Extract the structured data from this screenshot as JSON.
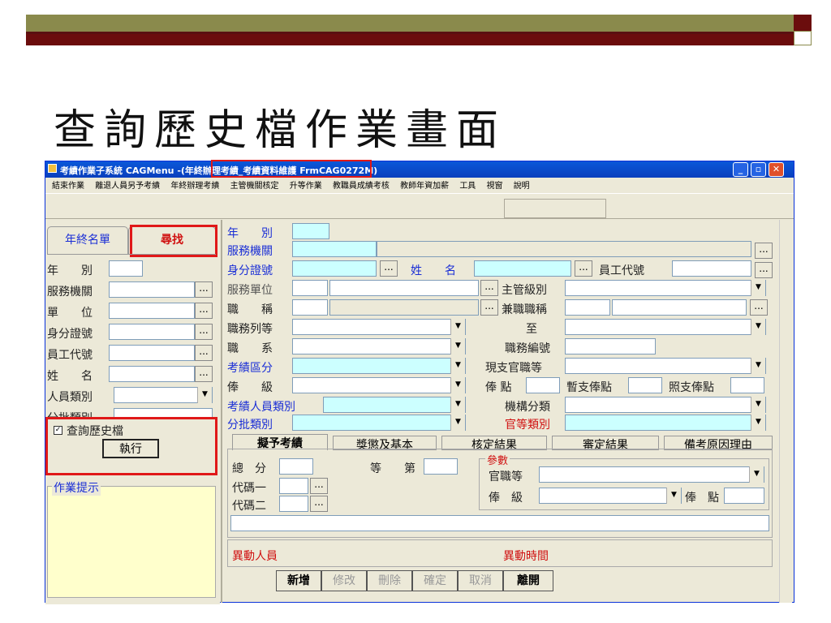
{
  "slide": {
    "title": "查詢歷史檔作業畫面"
  },
  "window": {
    "title": "考績作業子系統 CAGMenu -(年終辦理考績_考績資料維護 FrmCAG0272M)",
    "minimize": "_",
    "maximize": "▫",
    "close": "✕"
  },
  "menu": [
    "結束作業",
    "離退人員另予考績",
    "年終辦理考績",
    "主管機關核定",
    "升等作業",
    "教職員成績考核",
    "教師年資加薪",
    "工具",
    "視窗",
    "說明"
  ],
  "left_panel": {
    "tabs": [
      "年終名單",
      "尋找"
    ],
    "fields": [
      "年　　別",
      "服務機關",
      "單　　位",
      "身分證號",
      "員工代號",
      "姓　　名",
      "人員類別",
      "分批類別"
    ],
    "history_checkbox": "查詢歷史檔",
    "history_checked": true,
    "execute_button": "執行",
    "tips_label": "作業提示"
  },
  "main_form": {
    "year": "年　　別",
    "agency": "服務機關",
    "id_no": "身分證號",
    "name": "姓　　名",
    "emp_code": "員工代號",
    "unit": "服務單位",
    "supervisor_level": "主管級別",
    "position": "職　　稱",
    "concurrent_position": "兼職職稱",
    "rank_series": "職務列等",
    "to": "至",
    "series": "職　　系",
    "post_no": "職務編號",
    "eval_zone": "考績區分",
    "current_rank": "現支官職等",
    "salary_grade": "俸　　級",
    "salary_points": "俸 點",
    "temp_points": "暫支俸點",
    "actual_points": "照支俸點",
    "eval_person_type": "考績人員類別",
    "org_category": "機構分類",
    "batch_type": "分批類別",
    "rank_type": "官等類別"
  },
  "subtabs": [
    "擬予考績",
    "獎懲及基本",
    "核定結果",
    "審定結果",
    "備考原因理由"
  ],
  "eval_tab": {
    "total_score": "總　分",
    "grade": "等　　第",
    "code1": "代碼一",
    "code2": "代碼二",
    "params_group": "參數",
    "param_rank": "官職等",
    "param_grade": "俸　級",
    "param_points": "俸　點"
  },
  "changes": {
    "person": "異動人員",
    "time": "異動時間"
  },
  "actions": [
    "新增",
    "修改",
    "刪除",
    "確定",
    "取消",
    "離開"
  ],
  "colors": {
    "highlight_red": "#e01818",
    "required_blue": "#1a2ed6",
    "input_cyan": "#ccffff",
    "tips_yellow": "#ffffcc"
  }
}
